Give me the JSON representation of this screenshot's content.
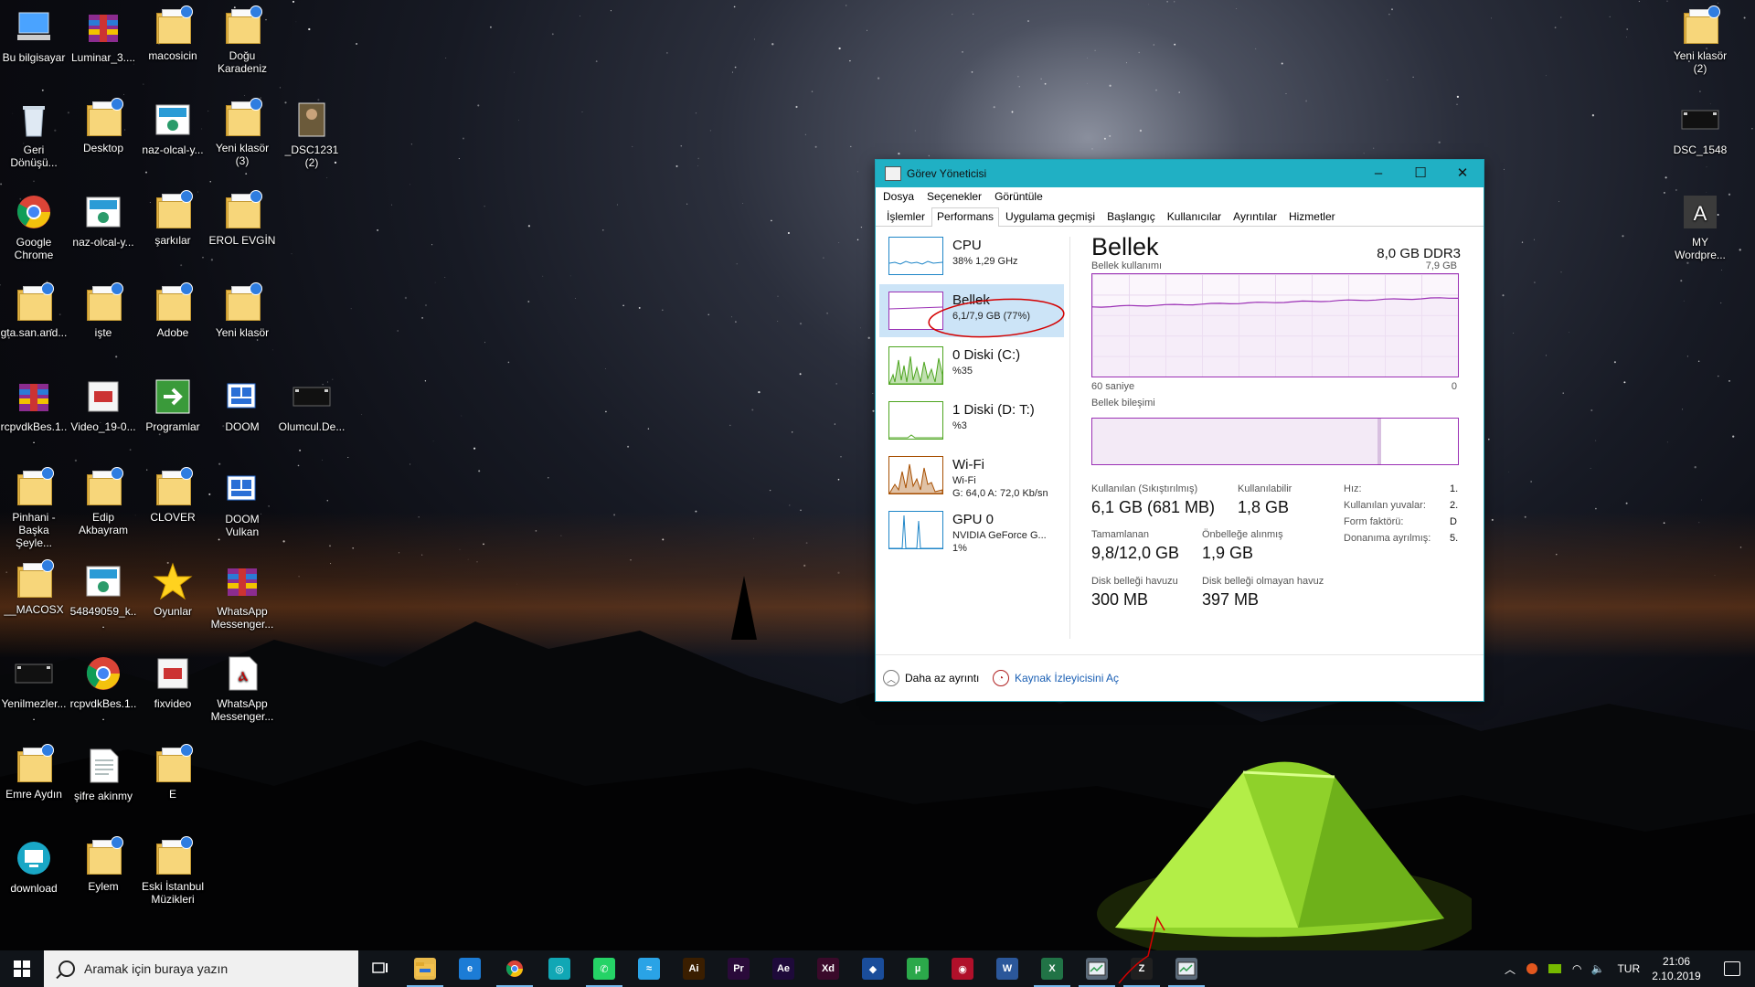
{
  "desktop": {
    "icons": [
      {
        "label": "Bu bilgisayar",
        "type": "pc"
      },
      {
        "label": "Luminar_3....",
        "type": "archive"
      },
      {
        "label": "macosicin",
        "type": "folder"
      },
      {
        "label": "Doğu Karadeniz",
        "type": "folder"
      },
      {
        "label": "Geri Dönüşü...",
        "type": "recycle"
      },
      {
        "label": "Desktop",
        "type": "folder"
      },
      {
        "label": "naz-olcal-y...",
        "type": "image"
      },
      {
        "label": "Yeni klasör (3)",
        "type": "folder"
      },
      {
        "label": "_DSC1231 (2)",
        "type": "photo"
      },
      {
        "label": "Google Chrome",
        "type": "chrome"
      },
      {
        "label": "naz-olcal-y...",
        "type": "image"
      },
      {
        "label": "şarkılar",
        "type": "folder"
      },
      {
        "label": "EROL EVGİN",
        "type": "folder"
      },
      {
        "label": "gta.san.and...",
        "type": "folder"
      },
      {
        "label": "işte",
        "type": "folder"
      },
      {
        "label": "Adobe",
        "type": "folder"
      },
      {
        "label": "Yeni klasör",
        "type": "folder"
      },
      {
        "label": "rcpvdkBes.1...",
        "type": "archive"
      },
      {
        "label": "Video_19-0...",
        "type": "file"
      },
      {
        "label": "Programlar",
        "type": "green"
      },
      {
        "label": "DOOM",
        "type": "app"
      },
      {
        "label": "Olumcul.De...",
        "type": "video"
      },
      {
        "label": "Pinhani - Başka Şeyle...",
        "type": "folder"
      },
      {
        "label": "Edip Akbayram",
        "type": "folder"
      },
      {
        "label": "CLOVER",
        "type": "folder"
      },
      {
        "label": "DOOM Vulkan",
        "type": "app"
      },
      {
        "label": "__MACOSX",
        "type": "folder"
      },
      {
        "label": "54849059_k...",
        "type": "image"
      },
      {
        "label": "Oyunlar",
        "type": "star"
      },
      {
        "label": "WhatsApp Messenger...",
        "type": "archive"
      },
      {
        "label": "Yenilmezler....",
        "type": "video"
      },
      {
        "label": "rcpvdkBes.1...",
        "type": "chrome"
      },
      {
        "label": "fixvideo",
        "type": "file"
      },
      {
        "label": "WhatsApp Messenger...",
        "type": "pdf"
      },
      {
        "label": "Emre Aydın",
        "type": "folder"
      },
      {
        "label": "şifre akinmy",
        "type": "text"
      },
      {
        "label": "E",
        "type": "folder"
      },
      {
        "label": "download",
        "type": "download"
      },
      {
        "label": "Eylem",
        "type": "folder"
      },
      {
        "label": "Eski İstanbul Müzikleri",
        "type": "folder"
      },
      {
        "label": "Yeni klasör (2)",
        "type": "folder"
      },
      {
        "label": "DSC_1548",
        "type": "video"
      },
      {
        "label": "MY Wordpre...",
        "type": "letter"
      }
    ]
  },
  "taskmanager": {
    "title": "Görev Yöneticisi",
    "menu": [
      "Dosya",
      "Seçenekler",
      "Görüntüle"
    ],
    "tabs": [
      "İşlemler",
      "Performans",
      "Uygulama geçmişi",
      "Başlangıç",
      "Kullanıcılar",
      "Ayrıntılar",
      "Hizmetler"
    ],
    "sidebar": [
      {
        "name": "CPU",
        "line1": "38% 1,29 GHz",
        "line2": "",
        "color": "#1f86c8"
      },
      {
        "name": "Bellek",
        "line1": "6,1/7,9 GB (77%)",
        "line2": "",
        "color": "#9b30b5"
      },
      {
        "name": "0 Diski (C:)",
        "line1": "%35",
        "line2": "",
        "color": "#4da51f"
      },
      {
        "name": "1 Diski (D: T:)",
        "line1": "%3",
        "line2": "",
        "color": "#4da51f"
      },
      {
        "name": "Wi-Fi",
        "line1": "Wi-Fi",
        "line2": "G: 64,0 A: 72,0 Kb/sn",
        "color": "#a74f01"
      },
      {
        "name": "GPU 0",
        "line1": "NVIDIA GeForce G...",
        "line2": "1%",
        "color": "#1f86c8"
      }
    ],
    "detail": {
      "title": "Bellek",
      "type": "8,0 GB DDR3",
      "usage_label": "Bellek kullanımı",
      "max_label": "7,9 GB",
      "time_left": "60 saniye",
      "time_right": "0",
      "composition_label": "Bellek bileşimi",
      "usage_fraction": 0.77,
      "stats": [
        {
          "label": "Kullanılan (Sıkıştırılmış)",
          "value": "6,1 GB (681 MB)"
        },
        {
          "label": "Kullanılabilir",
          "value": "1,8 GB"
        },
        {
          "label": "Tamamlanan",
          "value": "9,8/12,0 GB"
        },
        {
          "label": "Önbelleğe alınmış",
          "value": "1,9 GB"
        },
        {
          "label": "Disk belleği havuzu",
          "value": "300 MB"
        },
        {
          "label": "Disk belleği olmayan havuz",
          "value": "397 MB"
        }
      ],
      "specs": [
        {
          "label": "Hız:",
          "value": "1."
        },
        {
          "label": "Kullanılan yuvalar:",
          "value": "2."
        },
        {
          "label": "Form faktörü:",
          "value": "D"
        },
        {
          "label": "Donanıma ayrılmış:",
          "value": "5."
        }
      ]
    },
    "footer": {
      "less_details": "Daha az ayrıntı",
      "resource_monitor": "Kaynak İzleyicisini Aç"
    }
  },
  "taskbar": {
    "search_placeholder": "Aramak için buraya yazın",
    "language": "TUR",
    "time": "21:06",
    "date": "2.10.2019",
    "apps": [
      {
        "name": "task-view",
        "label": "",
        "color": "#101419"
      },
      {
        "name": "file-explorer",
        "label": "",
        "color": "#e8b94a"
      },
      {
        "name": "edge",
        "label": "e",
        "color": "#1c7cd6"
      },
      {
        "name": "chrome",
        "label": "",
        "color": "#d93025"
      },
      {
        "name": "app-teal",
        "label": "◎",
        "color": "#11a7b5"
      },
      {
        "name": "whatsapp",
        "label": "✆",
        "color": "#25d366"
      },
      {
        "name": "app-blue",
        "label": "≈",
        "color": "#2aa3e6"
      },
      {
        "name": "illustrator",
        "label": "Ai",
        "color": "#3a1e00"
      },
      {
        "name": "premiere",
        "label": "Pr",
        "color": "#2a0a3a"
      },
      {
        "name": "after-effects",
        "label": "Ae",
        "color": "#1e0a3a"
      },
      {
        "name": "xd",
        "label": "Xd",
        "color": "#3a0a2a"
      },
      {
        "name": "app-cube",
        "label": "◆",
        "color": "#1a4d9a"
      },
      {
        "name": "utorrent",
        "label": "µ",
        "color": "#2ba84a"
      },
      {
        "name": "app-red",
        "label": "◉",
        "color": "#b0102a"
      },
      {
        "name": "word",
        "label": "W",
        "color": "#2b579a"
      },
      {
        "name": "excel",
        "label": "X",
        "color": "#217346"
      },
      {
        "name": "taskmgr-pin",
        "label": "",
        "color": "#5c6b7a"
      },
      {
        "name": "app-z",
        "label": "Z",
        "color": "#202020"
      },
      {
        "name": "taskmgr-running",
        "label": "",
        "color": "#5c6b7a"
      }
    ]
  }
}
